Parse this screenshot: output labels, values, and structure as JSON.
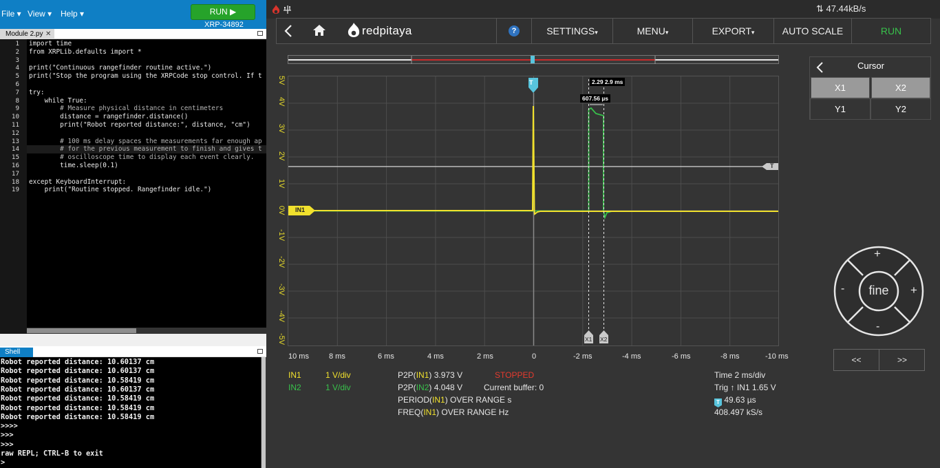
{
  "xrp": {
    "menu": [
      "File",
      "View",
      "Help"
    ],
    "run_label": "RUN ▶",
    "device_id": "XRP-34892",
    "tab_name": "Module 2.py",
    "tab_close": "✕",
    "code_lines": [
      "import time",
      "from XRPLib.defaults import *",
      "",
      "print(\"Continuous rangefinder routine active.\")",
      "print(\"Stop the program using the XRPCode stop control. If t",
      "",
      "try:",
      "    while True:",
      "        # Measure physical distance in centimeters",
      "        distance = rangefinder.distance()",
      "        print(\"Robot reported distance:\", distance, \"cm\")",
      "",
      "        # 100 ms delay spaces the measurements far enough ap",
      "        # for the previous measurement to finish and gives t",
      "        # oscilloscope time to display each event clearly.",
      "        time.sleep(0.1)",
      "",
      "except KeyboardInterrupt:",
      "    print(\"Routine stopped. Rangefinder idle.\")"
    ],
    "line_numbers": [
      "1",
      "2",
      "3",
      "4",
      "5",
      "6",
      "7",
      "8",
      "9",
      "10",
      "11",
      "12",
      "13",
      "14",
      "15",
      "16",
      "17",
      "18",
      "19"
    ],
    "shell_tab": "Shell",
    "shell_lines": [
      "Robot reported distance: 10.60137 cm",
      "Robot reported distance: 10.60137 cm",
      "Robot reported distance: 10.58419 cm",
      "Robot reported distance: 10.60137 cm",
      "Robot reported distance: 10.58419 cm",
      "Robot reported distance: 10.58419 cm",
      "Robot reported distance: 10.58419 cm",
      ">>>>",
      ">>>",
      ">>>",
      "raw REPL; CTRL-B to exit",
      ">"
    ]
  },
  "rp": {
    "throughput": "47.44kB/s",
    "logo": "redpitaya",
    "help": "?",
    "nav": {
      "settings": "SETTINGS",
      "menu": "MENU",
      "export": "EXPORT",
      "auto_scale": "AUTO SCALE",
      "run": "RUN"
    },
    "trigger_marker": "T",
    "in1_marker": "IN1",
    "cursor_x1": "X1",
    "cursor_x2": "X2",
    "cursor_delta_label": "2.29",
    "cursor_x2_label": "2.9 ms",
    "cursor_dt_label": "607.56 µs",
    "y_ticks": [
      "5V",
      "4V",
      "3V",
      "2V",
      "1V",
      "0V",
      "-1V",
      "-2V",
      "-3V",
      "-4V",
      "-5V"
    ],
    "x_ticks": [
      "10 ms",
      "8 ms",
      "6 ms",
      "4 ms",
      "2 ms",
      "0",
      "-2 ms",
      "-4 ms",
      "-6 ms",
      "-8 ms",
      "-10 ms"
    ],
    "info": {
      "in1": "IN1",
      "in1_scale": "1 V/div",
      "in2": "IN2",
      "in2_scale": "1 V/div",
      "p2p_in1_prefix": "P2P(",
      "p2p_in1_ch": "IN1",
      "p2p_in1_val": ") 3.973 V",
      "p2p_in2_prefix": "P2P(",
      "p2p_in2_ch": "IN2",
      "p2p_in2_val": ") 4.048 V",
      "period_prefix": "PERIOD(",
      "period_ch": "IN1",
      "period_val": ") OVER RANGE s",
      "freq_prefix": "FREQ(",
      "freq_ch": "IN1",
      "freq_val": ") OVER RANGE Hz",
      "status": "STOPPED",
      "buffer": "Current buffer: 0",
      "time": "Time 2 ms/div",
      "trig": "Trig ↑ IN1 1.65 V",
      "trig_delay": "49.63 µs",
      "sample_rate": "408.497 kS/s"
    },
    "cursor_panel": {
      "title": "Cursor",
      "x1": "X1",
      "x2": "X2",
      "y1": "Y1",
      "y2": "Y2"
    },
    "dpad": {
      "center": "fine",
      "plus_top": "+",
      "plus_right": "+",
      "minus_left": "-",
      "minus_bottom": "-"
    },
    "zoom": {
      "left": "<<",
      "right": ">>"
    },
    "colors": {
      "in1": "#f1e12d",
      "in2": "#38c14b",
      "trigger": "#58c4dc",
      "run": "#38c14b",
      "stopped": "#e53a2e"
    }
  }
}
